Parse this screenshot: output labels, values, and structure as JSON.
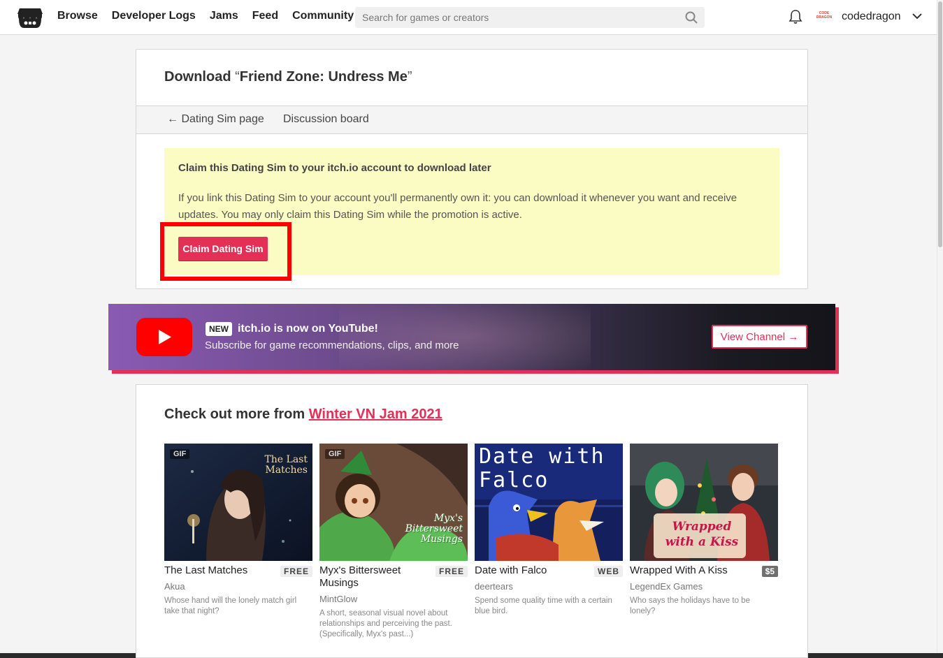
{
  "header": {
    "nav": [
      "Browse",
      "Developer Logs",
      "Jams",
      "Feed",
      "Community"
    ],
    "search_placeholder": "Search for games or creators",
    "username": "codedragon",
    "avatar_text": "CODE DRAGON"
  },
  "download": {
    "title_prefix": "Download",
    "open_quote": "“",
    "game_name": "Friend Zone: Undress Me",
    "close_quote": "”",
    "tab_back": "← Dating Sim page",
    "tab_discussion": "Discussion board",
    "claim_heading": "Claim this Dating Sim to your itch.io account to download later",
    "claim_text": "If you link this Dating Sim to your account you'll permanently own it: you can download it whenever you want and receive updates. You may only claim this Dating Sim while the promotion is active.",
    "claim_button": "Claim Dating Sim"
  },
  "youtube": {
    "badge": "NEW",
    "title": "itch.io is now on YouTube!",
    "subtitle": "Subscribe for game recommendations, clips, and more",
    "button": "View Channel →"
  },
  "more": {
    "title_prefix": "Check out more from ",
    "jam_name": "Winter VN Jam 2021",
    "games": [
      {
        "title": "The Last Matches",
        "price": "FREE",
        "author": "Akua",
        "desc": "Whose hand will the lonely match girl take that night?",
        "gif": "GIF",
        "cover_text": "The Last Matches"
      },
      {
        "title": "Myx's Bittersweet Musings",
        "price": "FREE",
        "author": "MintGlow",
        "desc": "A short, seasonal visual novel about relationships and perceiving the past. (Specifically, Myx's past...)",
        "gif": "GIF",
        "cover_text": "Myx's Bittersweet Musings"
      },
      {
        "title": "Date with Falco",
        "price": "WEB",
        "author": "deertears",
        "desc": "Spend some quality time with a certain blue bird.",
        "gif": "",
        "cover_text": "Date with Falco"
      },
      {
        "title": "Wrapped With A Kiss",
        "price": "$5",
        "author": "LegendEx Games",
        "desc": "Who says the holidays have to be lonely?",
        "gif": "",
        "cover_text": "Wrapped with a Kiss"
      }
    ]
  },
  "colors": {
    "accent": "#e43057",
    "claim_bg": "#fbfbc4",
    "highlight": "#ff0000"
  }
}
